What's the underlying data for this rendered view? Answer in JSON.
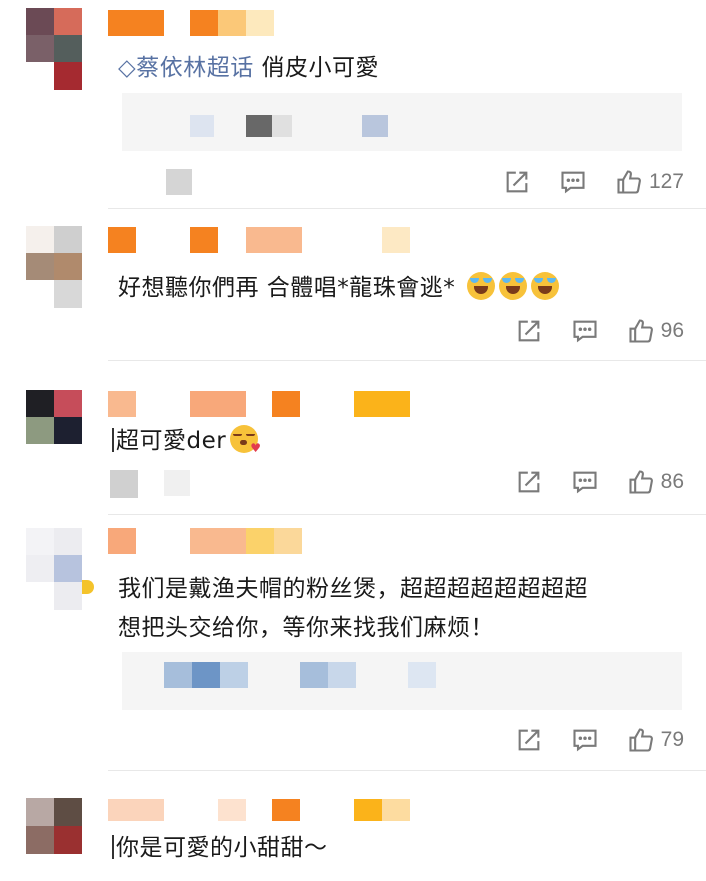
{
  "comments": [
    {
      "text_tag": "◇蔡依林超话",
      "text": " 俏皮小可愛",
      "likes": "127"
    },
    {
      "text": "好想聽你們再 合體唱*龍珠會逃* ",
      "emoji": "laugh-cry",
      "likes": "96"
    },
    {
      "text": "超可愛der",
      "emoji": "kiss-heart",
      "likes": "86"
    },
    {
      "text_line1": "我们是戴渔夫帽的粉丝煲，超超超超超超超超",
      "text_line2": "想把头交给你，等你来找我们麻烦！",
      "likes": "79"
    },
    {
      "text": "你是可愛的小甜甜～"
    }
  ],
  "colors": {
    "tag": "#5872a3",
    "icon": "#7a7a7a",
    "name_orange": "#f58220"
  },
  "icons": [
    "share-icon",
    "comment-icon",
    "like-icon"
  ]
}
